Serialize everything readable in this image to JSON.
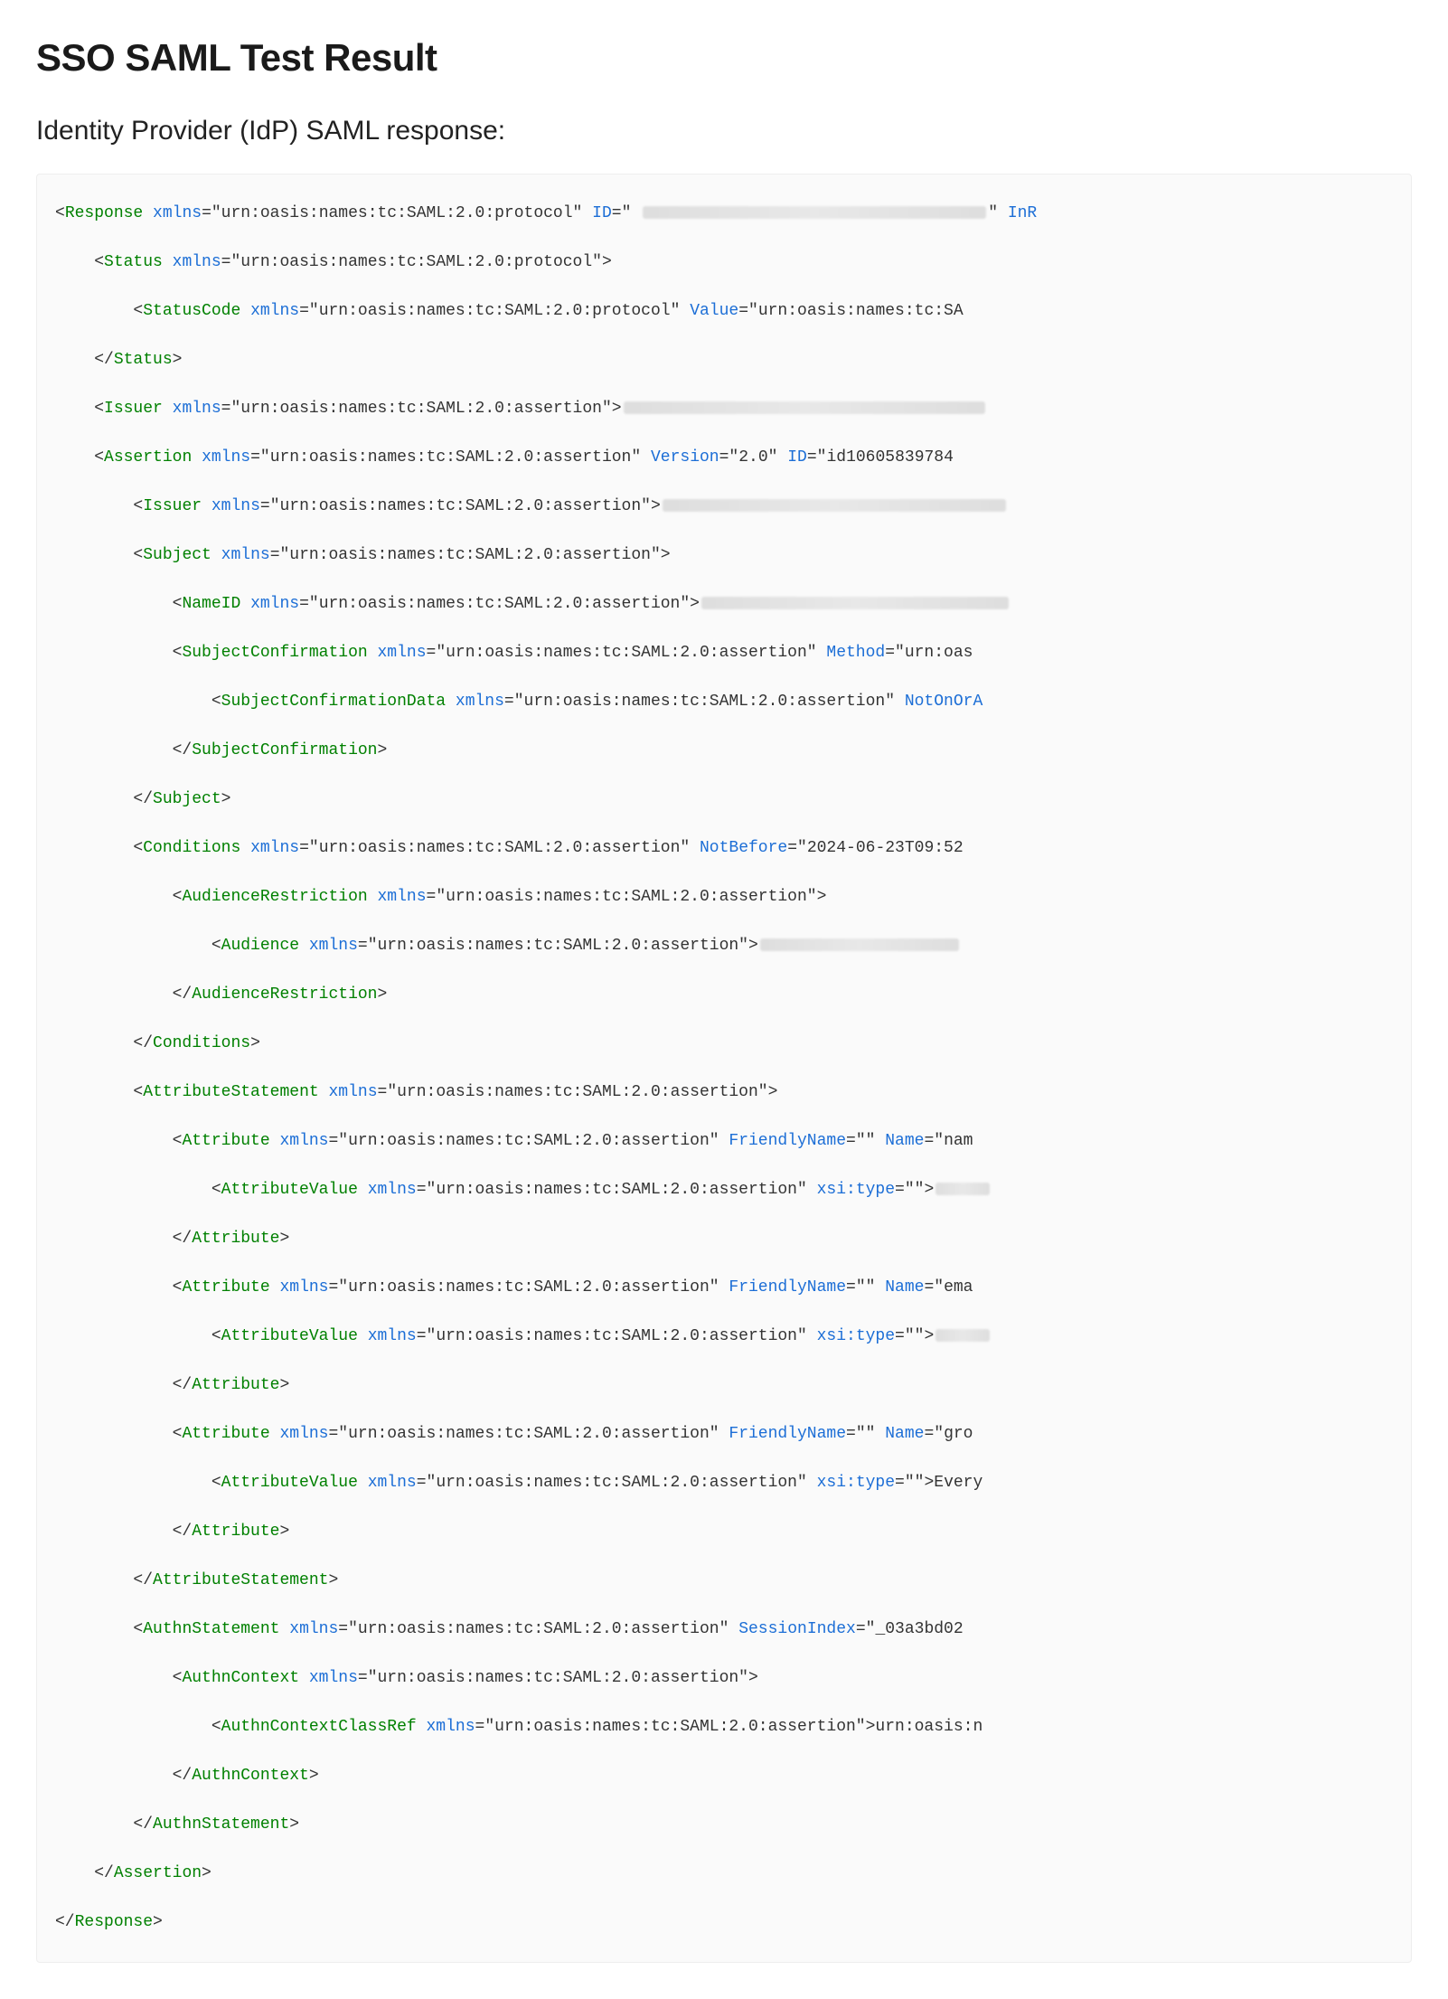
{
  "title": "SSO SAML Test Result",
  "subtitle": "Identity Provider (IdP) SAML response:",
  "xml": {
    "protocol_ns": "urn:oasis:names:tc:SAML:2.0:protocol",
    "assertion_ns": "urn:oasis:names:tc:SAML:2.0:assertion",
    "response": {
      "xmlns": "urn:oasis:names:tc:SAML:2.0:protocol",
      "id_prefix": "ID",
      "inr": "InR"
    },
    "status": {
      "xmlns": "urn:oasis:names:tc:SAML:2.0:protocol"
    },
    "status_code": {
      "xmlns": "urn:oasis:names:tc:SAML:2.0:protocol",
      "value_attr": "Value",
      "value": "urn:oasis:names:tc:SA"
    },
    "issuer": {
      "xmlns": "urn:oasis:names:tc:SAML:2.0:assertion"
    },
    "assertion": {
      "xmlns": "urn:oasis:names:tc:SAML:2.0:assertion",
      "version": "2.0",
      "id": "id10605839784"
    },
    "assertion_issuer": {
      "xmlns": "urn:oasis:names:tc:SAML:2.0:assertion"
    },
    "subject": {
      "xmlns": "urn:oasis:names:tc:SAML:2.0:assertion"
    },
    "nameid": {
      "xmlns": "urn:oasis:names:tc:SAML:2.0:assertion"
    },
    "subject_confirmation": {
      "xmlns": "urn:oasis:names:tc:SAML:2.0:assertion",
      "method_attr": "Method",
      "method": "urn:oas"
    },
    "subject_confirmation_data": {
      "xmlns": "urn:oasis:names:tc:SAML:2.0:assertion",
      "not_on_or_a": "NotOnOrA"
    },
    "conditions": {
      "xmlns": "urn:oasis:names:tc:SAML:2.0:assertion",
      "not_before_attr": "NotBefore",
      "not_before": "2024-06-23T09:52"
    },
    "audience_restriction": {
      "xmlns": "urn:oasis:names:tc:SAML:2.0:assertion"
    },
    "audience": {
      "xmlns": "urn:oasis:names:tc:SAML:2.0:assertion"
    },
    "attribute_statement": {
      "xmlns": "urn:oasis:names:tc:SAML:2.0:assertion"
    },
    "attributes": [
      {
        "xmlns": "urn:oasis:names:tc:SAML:2.0:assertion",
        "friendly_name_attr": "FriendlyName",
        "friendly_name": "",
        "name_attr": "Name",
        "name": "nam",
        "value_xmlns": "urn:oasis:names:tc:SAML:2.0:assertion",
        "xsi_type_attr": "xsi:type",
        "xsi_type": ""
      },
      {
        "xmlns": "urn:oasis:names:tc:SAML:2.0:assertion",
        "friendly_name_attr": "FriendlyName",
        "friendly_name": "",
        "name_attr": "Name",
        "name": "ema",
        "value_xmlns": "urn:oasis:names:tc:SAML:2.0:assertion",
        "xsi_type_attr": "xsi:type",
        "xsi_type": ""
      },
      {
        "xmlns": "urn:oasis:names:tc:SAML:2.0:assertion",
        "friendly_name_attr": "FriendlyName",
        "friendly_name": "",
        "name_attr": "Name",
        "name": "gro",
        "value_xmlns": "urn:oasis:names:tc:SAML:2.0:assertion",
        "xsi_type_attr": "xsi:type",
        "xsi_type": "",
        "value_text": "Every"
      }
    ],
    "authn_statement": {
      "xmlns": "urn:oasis:names:tc:SAML:2.0:assertion",
      "session_index_attr": "SessionIndex",
      "session_index": "_03a3bd02"
    },
    "authn_context": {
      "xmlns": "urn:oasis:names:tc:SAML:2.0:assertion"
    },
    "authn_context_class_ref": {
      "xmlns": "urn:oasis:names:tc:SAML:2.0:assertion",
      "text": "urn:oasis:n"
    }
  }
}
